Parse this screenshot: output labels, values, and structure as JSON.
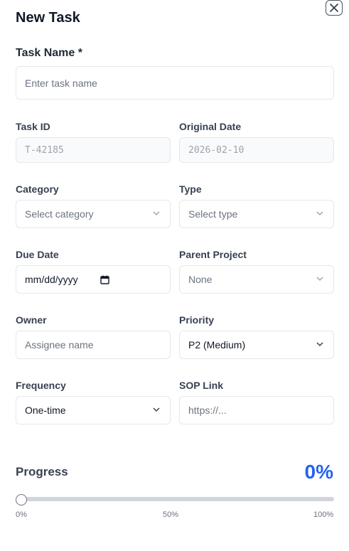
{
  "dialog": {
    "title": "New Task",
    "close_icon": "close-icon"
  },
  "fields": {
    "task_name": {
      "label": "Task Name *",
      "placeholder": "Enter task name"
    },
    "task_id": {
      "label": "Task ID",
      "value": "T-42185"
    },
    "original_date": {
      "label": "Original Date",
      "value": "2026-02-10"
    },
    "category": {
      "label": "Category",
      "value": "Select category"
    },
    "type": {
      "label": "Type",
      "value": "Select type"
    },
    "due_date": {
      "label": "Due Date",
      "value": "mm/dd/yyyy"
    },
    "parent_project": {
      "label": "Parent Project",
      "value": "None"
    },
    "owner": {
      "label": "Owner",
      "placeholder": "Assignee name"
    },
    "priority": {
      "label": "Priority",
      "value": "P2 (Medium)"
    },
    "frequency": {
      "label": "Frequency",
      "value": "One-time"
    },
    "sop_link": {
      "label": "SOP Link",
      "placeholder": "https://..."
    }
  },
  "progress": {
    "label": "Progress",
    "value_text": "0%",
    "value": 0,
    "ticks": [
      "0%",
      "50%",
      "100%"
    ]
  },
  "colors": {
    "accent": "#2563eb",
    "border": "#e5e7eb",
    "disabled_bg": "#f9fafb"
  }
}
